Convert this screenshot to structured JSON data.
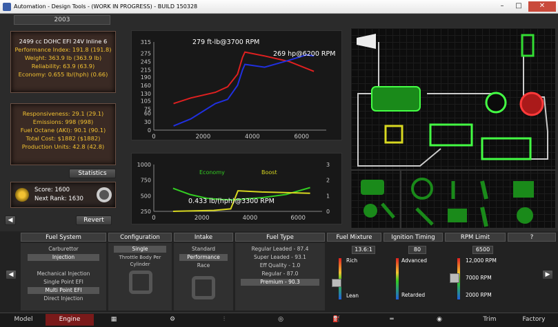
{
  "window": {
    "title": "Automation - Design Tools - (WORK IN PROGRESS) - BUILD 150328",
    "minimize": "–",
    "maximize": "□",
    "close": "✕"
  },
  "year": "2003",
  "engine_info": {
    "name": "2499 cc DOHC EFI 24V Inline 6",
    "performance_index": "Performance Index: 191.8 (191.8)",
    "weight": "Weight: 363.9 lb (363.9 lb)",
    "reliability": "Reliability: 63.9 (63.9)",
    "economy": "Economy: 0.655 lb/(hph) (0.66)"
  },
  "engine_stats": {
    "responsiveness": "Responsiveness: 29.1 (29.1)",
    "emissions": "Emissions: 998 (998)",
    "fuel_octane": "Fuel Octane (AKI): 90.1 (90.1)",
    "total_cost": "Total Cost: $1882 ($1882)",
    "production_units": "Production Units: 42.8 (42.8)"
  },
  "statistics_button": "Statistics",
  "score": {
    "score": "Score: 1600",
    "next_rank": "Next Rank: 1630"
  },
  "revert_button": "Revert",
  "colors": {
    "torque": "#e02020",
    "power": "#2030e0",
    "economy": "#33cc22",
    "boost": "#d8d820",
    "accent": "#f3c232"
  },
  "chart_data": [
    {
      "type": "line",
      "title": "",
      "x_ticks": [
        "0",
        "2000",
        "4000",
        "6000"
      ],
      "y_ticks": [
        "0",
        "30",
        "60",
        "75",
        "105",
        "130",
        "160",
        "190",
        "215",
        "245",
        "275",
        "315"
      ],
      "annotations": [
        "279 ft-lb@3700 RPM",
        "269 hp@6200 RPM"
      ],
      "xlim": [
        0,
        7000
      ],
      "ylim": [
        0,
        315
      ],
      "series": [
        {
          "name": "Torque",
          "x": [
            800,
            1500,
            2500,
            3000,
            3400,
            3600,
            3700,
            4500,
            5500,
            6500
          ],
          "y": [
            95,
            115,
            135,
            155,
            200,
            260,
            279,
            265,
            245,
            210
          ]
        },
        {
          "name": "Power",
          "x": [
            800,
            1500,
            2500,
            3000,
            3400,
            3600,
            3700,
            4500,
            5500,
            6200,
            6500
          ],
          "y": [
            15,
            40,
            95,
            110,
            160,
            215,
            235,
            225,
            250,
            269,
            265
          ]
        }
      ]
    },
    {
      "type": "line",
      "title": "",
      "x_ticks": [
        "0",
        "2000",
        "4000",
        "6000"
      ],
      "y_ticks": [
        "250",
        "500",
        "750",
        "1000"
      ],
      "y2_ticks": [
        "0",
        "1",
        "2",
        "3"
      ],
      "series_labels": [
        "Economy",
        "Boost"
      ],
      "annotations": [
        "0.433 lb/(hph)@3300 RPM"
      ],
      "xlim": [
        0,
        7000
      ],
      "ylim": [
        250,
        1000
      ],
      "series": [
        {
          "name": "Economy",
          "x": [
            800,
            1500,
            2200,
            2800,
            3300,
            3800,
            4500,
            5500,
            6500
          ],
          "y": [
            620,
            520,
            460,
            440,
            433,
            450,
            470,
            520,
            630
          ]
        },
        {
          "name": "Boost",
          "x": [
            800,
            2500,
            3200,
            3500,
            4500,
            6500
          ],
          "y": [
            250,
            265,
            290,
            580,
            560,
            540
          ]
        }
      ]
    }
  ],
  "bottom": {
    "columns": [
      "Fuel System",
      "Configuration",
      "Intake",
      "Fuel Type",
      "Fuel Mixture",
      "Ignition Timing",
      "RPM Limit",
      "?"
    ],
    "fuel_system": [
      "Carburettor",
      "Injection",
      "Mechanical Injection",
      "Single Point EFI",
      "Multi Point EFI",
      "Direct Injection"
    ],
    "configuration": [
      "Single",
      "Throttle Body Per Cylinder"
    ],
    "intake": [
      "Standard",
      "Performance",
      "Race"
    ],
    "fuel_type": [
      "Regular Leaded - 87.4",
      "Super Leaded - 93.1",
      "Eff Quality - 1.0",
      "Regular - 87.0",
      "Premium - 90.3"
    ],
    "fuel_mixture": {
      "value": "13.6:1",
      "rich": "Rich",
      "lean": "Lean"
    },
    "ignition_timing": {
      "value": "80",
      "advanced": "Advanced",
      "retarded": "Retarded"
    },
    "rpm_limit": {
      "value": "6500",
      "top": "12,000 RPM",
      "mid": "7000 RPM",
      "low": "2000 RPM"
    }
  },
  "nav": [
    "Model",
    "Engine",
    "Trim",
    "Factory"
  ]
}
